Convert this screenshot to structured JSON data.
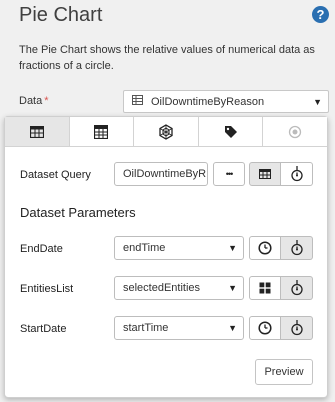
{
  "header": {
    "title": "Pie Chart",
    "help_icon": "?",
    "description": "The Pie Chart shows the relative values of numerical data as fractions of a circle."
  },
  "data_field": {
    "label": "Data",
    "required_marker": "*",
    "value": "OilDowntimeByReason"
  },
  "tabs": [
    {
      "name": "data-service-tab",
      "icon": "table-icon",
      "active": true
    },
    {
      "name": "calculator-tab",
      "icon": "calculator-icon",
      "active": false
    },
    {
      "name": "hexagon-tab",
      "icon": "hexagon-icon",
      "active": false
    },
    {
      "name": "tag-tab",
      "icon": "tag-icon",
      "active": false
    },
    {
      "name": "circle-tab",
      "icon": "circle-icon",
      "active": false
    }
  ],
  "dataset_query": {
    "label": "Dataset Query",
    "value": "OilDowntimeByR",
    "more_label": "•••"
  },
  "dataset_parameters": {
    "title": "Dataset Parameters",
    "params": [
      {
        "label": "EndDate",
        "value": "endTime",
        "button_icon": "clock-icon"
      },
      {
        "label": "EntitiesList",
        "value": "selectedEntities",
        "button_icon": "grid-icon"
      },
      {
        "label": "StartDate",
        "value": "startTime",
        "button_icon": "clock-icon"
      }
    ]
  },
  "preview_label": "Preview",
  "colors": {
    "accent": "#2a6fb1",
    "required": "#d9534f",
    "active_tab": "#e6e6e6"
  }
}
